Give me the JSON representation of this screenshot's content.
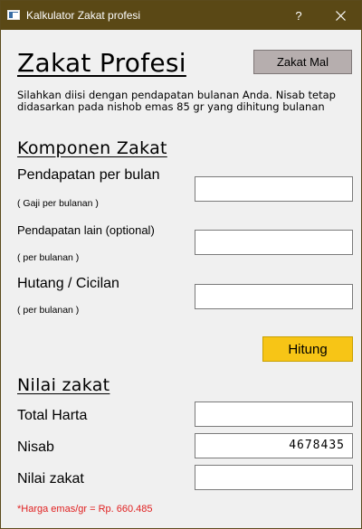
{
  "window": {
    "title": "Kalkulator Zakat profesi",
    "help_glyph": "?"
  },
  "header": {
    "title": "Zakat Profesi",
    "zakat_mal_label": "Zakat Mal",
    "description": "Silahkan diisi dengan pendapatan bulanan Anda. Nisab tetap didasarkan pada nishob emas 85 gr yang dihitung bulanan"
  },
  "komponen": {
    "title": "Komponen Zakat",
    "pendapatan": {
      "label": "Pendapatan per bulan",
      "hint": "( Gaji per bulanan )",
      "value": ""
    },
    "pendapatan_lain": {
      "label": "Pendapatan lain (optional)",
      "hint": "( per bulanan )",
      "value": ""
    },
    "hutang": {
      "label": "Hutang / Cicilan",
      "hint": "( per bulanan )",
      "value": ""
    },
    "hitung_label": "Hitung"
  },
  "nilai": {
    "title": "Nilai zakat",
    "total_harta": {
      "label": "Total Harta",
      "value": ""
    },
    "nisab": {
      "label": "Nisab",
      "value": "4678435"
    },
    "nilai_zakat": {
      "label": "Nilai zakat",
      "value": ""
    }
  },
  "footnote": "*Harga emas/gr = Rp. 660.485",
  "colors": {
    "titlebar": "#5a4815",
    "hitung_button": "#f7c516",
    "zakat_mal_button": "#b6aeae",
    "footnote": "#e02020"
  }
}
